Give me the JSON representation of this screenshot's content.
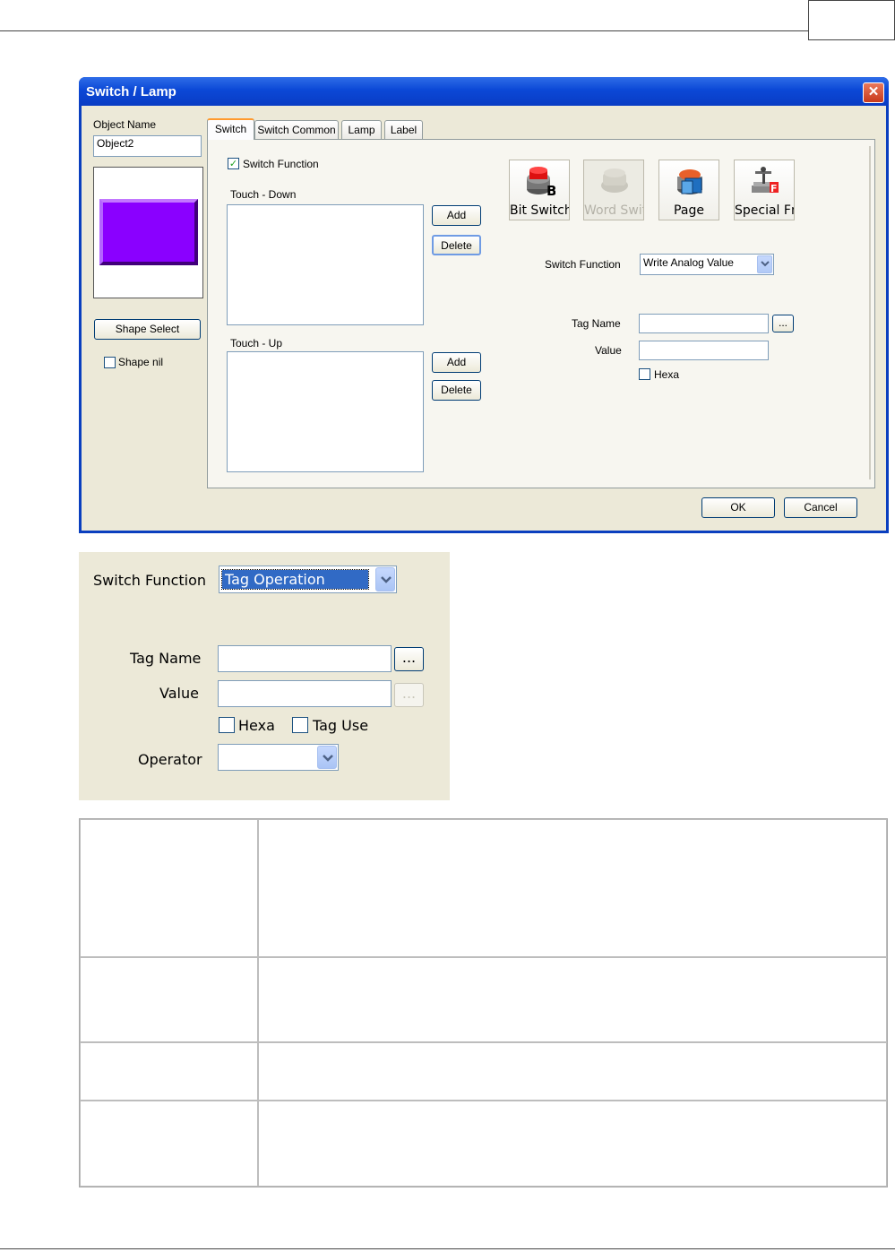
{
  "dialog": {
    "title": "Switch / Lamp",
    "close_glyph": "✕",
    "object_name_label": "Object Name",
    "object_name_value": "Object2",
    "shape_select_label": "Shape Select",
    "shape_nil_label": "Shape nil",
    "shape_color": "#8a00ff",
    "tabs": [
      "Switch",
      "Switch Common",
      "Lamp",
      "Label"
    ],
    "switch_function_check_label": "Switch Function",
    "touch_down_label": "Touch - Down",
    "touch_up_label": "Touch - Up",
    "add_label": "Add",
    "delete_label": "Delete",
    "tools": [
      {
        "label": "Bit Switch",
        "icon": "bit-switch-icon",
        "enabled": true
      },
      {
        "label": "Word Switch",
        "icon": "word-switch-icon",
        "enabled": false
      },
      {
        "label": "Page",
        "icon": "page-icon",
        "enabled": true
      },
      {
        "label": "Special Fn.",
        "icon": "special-fn-icon",
        "enabled": true
      }
    ],
    "switch_function_label": "Switch Function",
    "switch_function_value": "Write Analog Value",
    "tag_name_label": "Tag Name",
    "browse_label": "...",
    "value_label": "Value",
    "hexa_label": "Hexa",
    "ok_label": "OK",
    "cancel_label": "Cancel"
  },
  "zoom_panel": {
    "switch_function_label": "Switch Function",
    "switch_function_value": "Tag Operation",
    "tag_name_label": "Tag Name",
    "value_label": "Value",
    "browse_label": "...",
    "hexa_label": "Hexa",
    "tag_use_label": "Tag Use",
    "operator_label": "Operator",
    "operator_value": ""
  }
}
